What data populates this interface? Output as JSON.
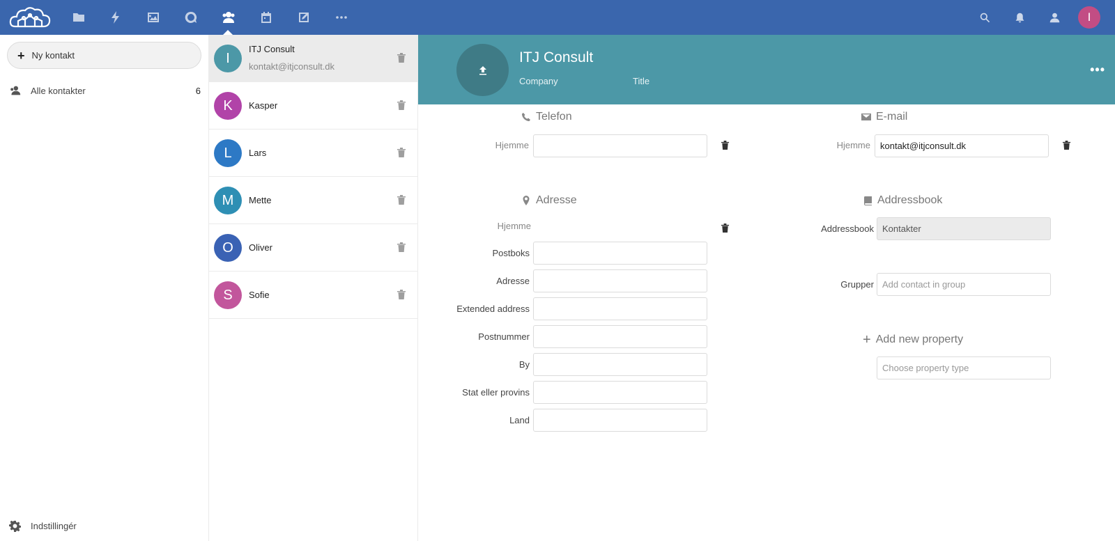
{
  "colors": {
    "header": "#3a66ad",
    "detail_header": "#4c98a7",
    "user_avatar": "#c24d84"
  },
  "header": {
    "apps": [
      {
        "name": "files-icon"
      },
      {
        "name": "activity-icon"
      },
      {
        "name": "gallery-icon"
      },
      {
        "name": "talk-icon"
      },
      {
        "name": "contacts-icon",
        "active": true
      },
      {
        "name": "calendar-icon"
      },
      {
        "name": "notes-icon"
      },
      {
        "name": "more-apps-icon"
      }
    ],
    "user_initial": "I"
  },
  "nav": {
    "new_contact": "Ny kontakt",
    "all_contacts": "Alle kontakter",
    "all_contacts_count": "6",
    "settings": "Indstillingér"
  },
  "contacts": [
    {
      "initial": "I",
      "name": "ITJ Consult",
      "email": "kontakt@itjconsult.dk",
      "color": "#4c98a7",
      "selected": true
    },
    {
      "initial": "K",
      "name": "Kasper",
      "email": "",
      "color": "#b143a8"
    },
    {
      "initial": "L",
      "name": "Lars",
      "email": "",
      "color": "#2d79c5"
    },
    {
      "initial": "M",
      "name": "Mette",
      "email": "",
      "color": "#2e8fb4"
    },
    {
      "initial": "O",
      "name": "Oliver",
      "email": "",
      "color": "#3a62b4"
    },
    {
      "initial": "S",
      "name": "Sofie",
      "email": "",
      "color": "#c2569c"
    }
  ],
  "detail": {
    "name": "ITJ Consult",
    "company_placeholder": "Company",
    "title_placeholder": "Title",
    "phone": {
      "title": "Telefon",
      "label": "Hjemme",
      "value": ""
    },
    "email": {
      "title": "E-mail",
      "label": "Hjemme",
      "value": "kontakt@itjconsult.dk"
    },
    "address": {
      "title": "Adresse",
      "type_label": "Hjemme",
      "fields": [
        {
          "label": "Postboks",
          "value": ""
        },
        {
          "label": "Adresse",
          "value": ""
        },
        {
          "label": "Extended address",
          "value": ""
        },
        {
          "label": "Postnummer",
          "value": ""
        },
        {
          "label": "By",
          "value": ""
        },
        {
          "label": "Stat eller provins",
          "value": ""
        },
        {
          "label": "Land",
          "value": ""
        }
      ]
    },
    "addressbook": {
      "title": "Addressbook",
      "label": "Addressbook",
      "value": "Kontakter"
    },
    "groups": {
      "label": "Grupper",
      "placeholder": "Add contact in group"
    },
    "add_property": {
      "label": "Add new property",
      "placeholder": "Choose property type"
    }
  }
}
